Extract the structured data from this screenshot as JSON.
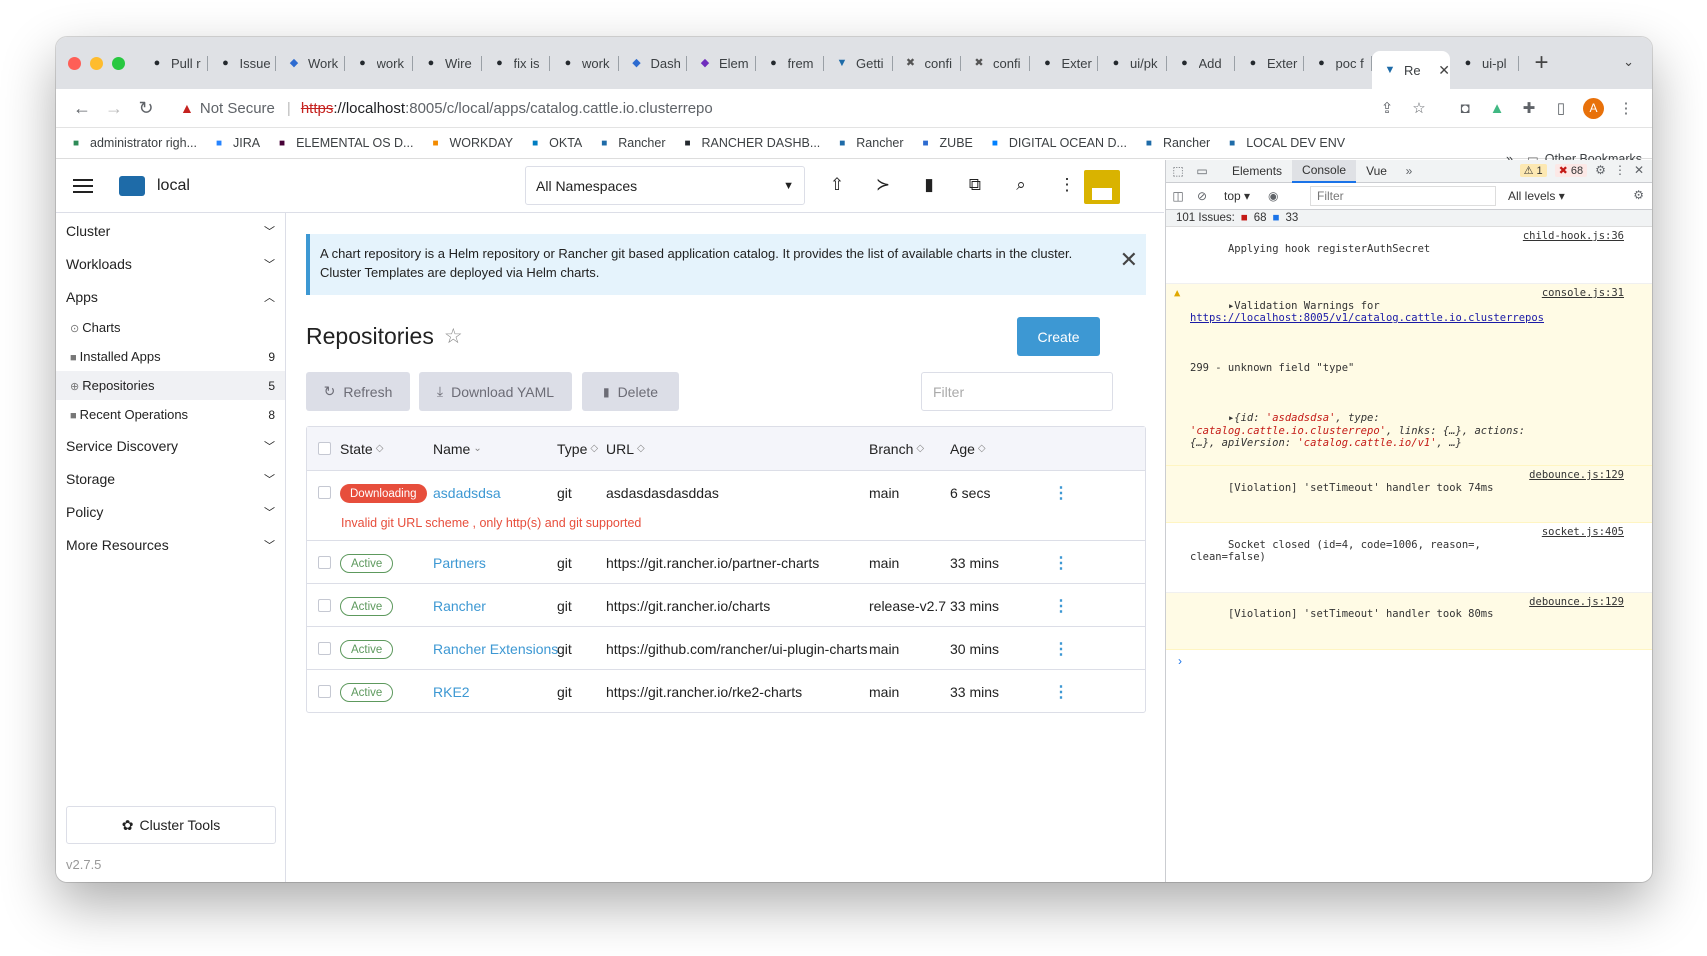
{
  "browser": {
    "tabs": [
      {
        "title": "Pull r",
        "icon": "github-icon"
      },
      {
        "title": "Issue",
        "icon": "github-icon"
      },
      {
        "title": "Work",
        "icon": "zube-icon"
      },
      {
        "title": "work",
        "icon": "github-icon"
      },
      {
        "title": "Wire",
        "icon": "github-icon"
      },
      {
        "title": "fix is",
        "icon": "github-icon"
      },
      {
        "title": "work",
        "icon": "github-icon"
      },
      {
        "title": "Dash",
        "icon": "zube-icon"
      },
      {
        "title": "Elem",
        "icon": "purple-icon"
      },
      {
        "title": "frem",
        "icon": "github-icon"
      },
      {
        "title": "Getti",
        "icon": "rancher-icon"
      },
      {
        "title": "confi",
        "icon": "tools-icon"
      },
      {
        "title": "confi",
        "icon": "tools-icon"
      },
      {
        "title": "Exter",
        "icon": "github-icon"
      },
      {
        "title": "ui/pk",
        "icon": "github-icon"
      },
      {
        "title": "Add",
        "icon": "github-icon"
      },
      {
        "title": "Exter",
        "icon": "github-icon"
      },
      {
        "title": "poc f",
        "icon": "github-icon"
      }
    ],
    "active_tab": {
      "title": "Re",
      "icon": "rancher-icon"
    },
    "after_tab": {
      "title": "ui-pl",
      "icon": "github-icon"
    },
    "url": {
      "warning": "Not Secure",
      "scheme": "https",
      "host": "://localhost",
      "path": ":8005/c/local/apps/catalog.cattle.io.clusterrepo"
    },
    "profile_initial": "A",
    "bookmarks": [
      {
        "label": "administrator righ...",
        "color": "#2e8b57"
      },
      {
        "label": "JIRA",
        "color": "#2684ff"
      },
      {
        "label": "ELEMENTAL OS D...",
        "color": "#470137"
      },
      {
        "label": "WORKDAY",
        "color": "#f38b00"
      },
      {
        "label": "OKTA",
        "color": "#007dc1"
      },
      {
        "label": "Rancher",
        "color": "#1e6ba8"
      },
      {
        "label": "RANCHER DASHB...",
        "color": "#24292e"
      },
      {
        "label": "Rancher",
        "color": "#1e6ba8"
      },
      {
        "label": "ZUBE",
        "color": "#2d6bd0"
      },
      {
        "label": "DIGITAL OCEAN D...",
        "color": "#0080ff"
      },
      {
        "label": "Rancher",
        "color": "#1e6ba8"
      },
      {
        "label": "LOCAL DEV ENV",
        "color": "#1e6ba8"
      }
    ],
    "bookmarks_more": "»",
    "other_bookmarks": "Other Bookmarks"
  },
  "app": {
    "cluster_name": "local",
    "namespace_select": "All Namespaces",
    "sidebar": {
      "groups_top": [
        {
          "label": "Cluster"
        },
        {
          "label": "Workloads"
        }
      ],
      "apps_group": "Apps",
      "apps_items": [
        {
          "label": "Charts",
          "count": "",
          "icon": "⊙"
        },
        {
          "label": "Installed Apps",
          "count": "9",
          "icon": "■"
        },
        {
          "label": "Repositories",
          "count": "5",
          "icon": "⊕"
        },
        {
          "label": "Recent Operations",
          "count": "8",
          "icon": "■"
        }
      ],
      "groups_bottom": [
        {
          "label": "Service Discovery"
        },
        {
          "label": "Storage"
        },
        {
          "label": "Policy"
        },
        {
          "label": "More Resources"
        }
      ],
      "cluster_tools": "Cluster Tools",
      "version": "v2.7.5"
    },
    "banner": "A chart repository is a Helm repository or Rancher git based application catalog. It provides the list of available charts in the cluster. Cluster Templates are deployed via Helm charts.",
    "page_title": "Repositories",
    "create_label": "Create",
    "refresh_label": "Refresh",
    "download_label": "Download YAML",
    "delete_label": "Delete",
    "filter_placeholder": "Filter",
    "table": {
      "headers": {
        "state": "State",
        "name": "Name",
        "type": "Type",
        "url": "URL",
        "branch": "Branch",
        "age": "Age"
      },
      "rows": [
        {
          "state": "Downloading",
          "name": "asdadsdsa",
          "type": "git",
          "url": "asdasdasdasddas",
          "branch": "main",
          "age": "6 secs",
          "error": "Invalid git URL scheme , only http(s) and git supported"
        },
        {
          "state": "Active",
          "name": "Partners",
          "type": "git",
          "url": "https://git.rancher.io/partner-charts",
          "branch": "main",
          "age": "33 mins"
        },
        {
          "state": "Active",
          "name": "Rancher",
          "type": "git",
          "url": "https://git.rancher.io/charts",
          "branch": "release-v2.7",
          "age": "33 mins"
        },
        {
          "state": "Active",
          "name": "Rancher Extensions",
          "type": "git",
          "url": "https://github.com/rancher/ui-plugin-charts",
          "branch": "main",
          "age": "30 mins"
        },
        {
          "state": "Active",
          "name": "RKE2",
          "type": "git",
          "url": "https://git.rancher.io/rke2-charts",
          "branch": "main",
          "age": "33 mins"
        }
      ]
    }
  },
  "devtools": {
    "tabs": [
      "Elements",
      "Console",
      "Vue"
    ],
    "more": "»",
    "warn_count": "1",
    "error_count": "68",
    "context": "top",
    "filter_placeholder": "Filter",
    "levels": "All levels",
    "issues_label": "101 Issues:",
    "issues_errors": "68",
    "issues_info": "33",
    "logs": {
      "l1": {
        "text": "Applying hook registerAuthSecret",
        "src": "child-hook.js:36"
      },
      "l2": {
        "prefix": "Validation Warnings for ",
        "link": "https://localhost:8005/v1/catalog.cattle.io.clusterrepos",
        "src": "console.js:31",
        "msg": "299 - unknown field \"type\""
      },
      "l3": {
        "id": "'asdadsdsa'",
        "type": "'catalog.cattle.io.clusterrepo'",
        "apiVersion": "'catalog.cattle.io/v1'"
      },
      "l4": {
        "text": "[Violation] 'setTimeout' handler took 74ms",
        "src": "debounce.js:129"
      },
      "l5": {
        "text": "Socket closed (id=4, code=1006, reason=, clean=false)",
        "src": "socket.js:405"
      },
      "l6": {
        "text": "[Violation] 'setTimeout' handler took 80ms",
        "src": "debounce.js:129"
      }
    },
    "prompt_symbol": "›"
  }
}
